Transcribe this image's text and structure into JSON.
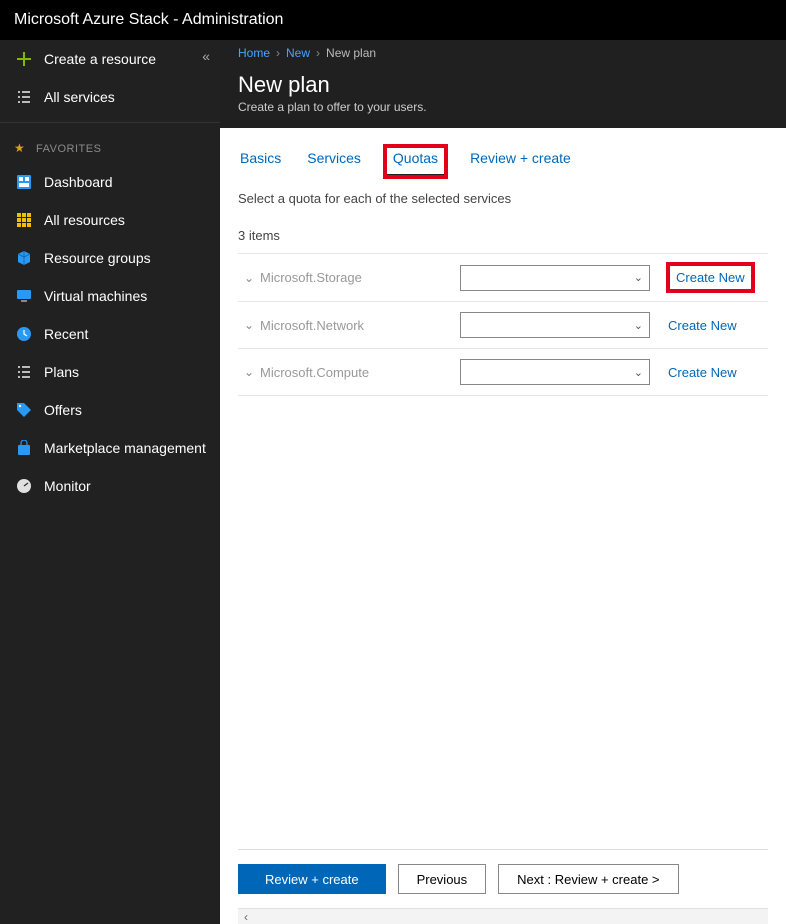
{
  "topbar": {
    "title": "Microsoft Azure Stack - Administration"
  },
  "sidebar": {
    "create": "Create a resource",
    "all_services": "All services",
    "favorites_label": "FAVORITES",
    "items": [
      {
        "label": "Dashboard"
      },
      {
        "label": "All resources"
      },
      {
        "label": "Resource groups"
      },
      {
        "label": "Virtual machines"
      },
      {
        "label": "Recent"
      },
      {
        "label": "Plans"
      },
      {
        "label": "Offers"
      },
      {
        "label": "Marketplace management"
      },
      {
        "label": "Monitor"
      }
    ]
  },
  "breadcrumbs": {
    "home": "Home",
    "new": "New",
    "current": "New plan"
  },
  "page": {
    "title": "New plan",
    "subtitle": "Create a plan to offer to your users."
  },
  "tabs": {
    "basics": "Basics",
    "services": "Services",
    "quotas": "Quotas",
    "review": "Review + create"
  },
  "quotas": {
    "instruction": "Select a quota for each of the selected services",
    "count_label": "3 items",
    "rows": [
      {
        "service": "Microsoft.Storage",
        "create_new": "Create New"
      },
      {
        "service": "Microsoft.Network",
        "create_new": "Create New"
      },
      {
        "service": "Microsoft.Compute",
        "create_new": "Create New"
      }
    ]
  },
  "footer": {
    "review": "Review + create",
    "previous": "Previous",
    "next": "Next : Review + create >"
  }
}
